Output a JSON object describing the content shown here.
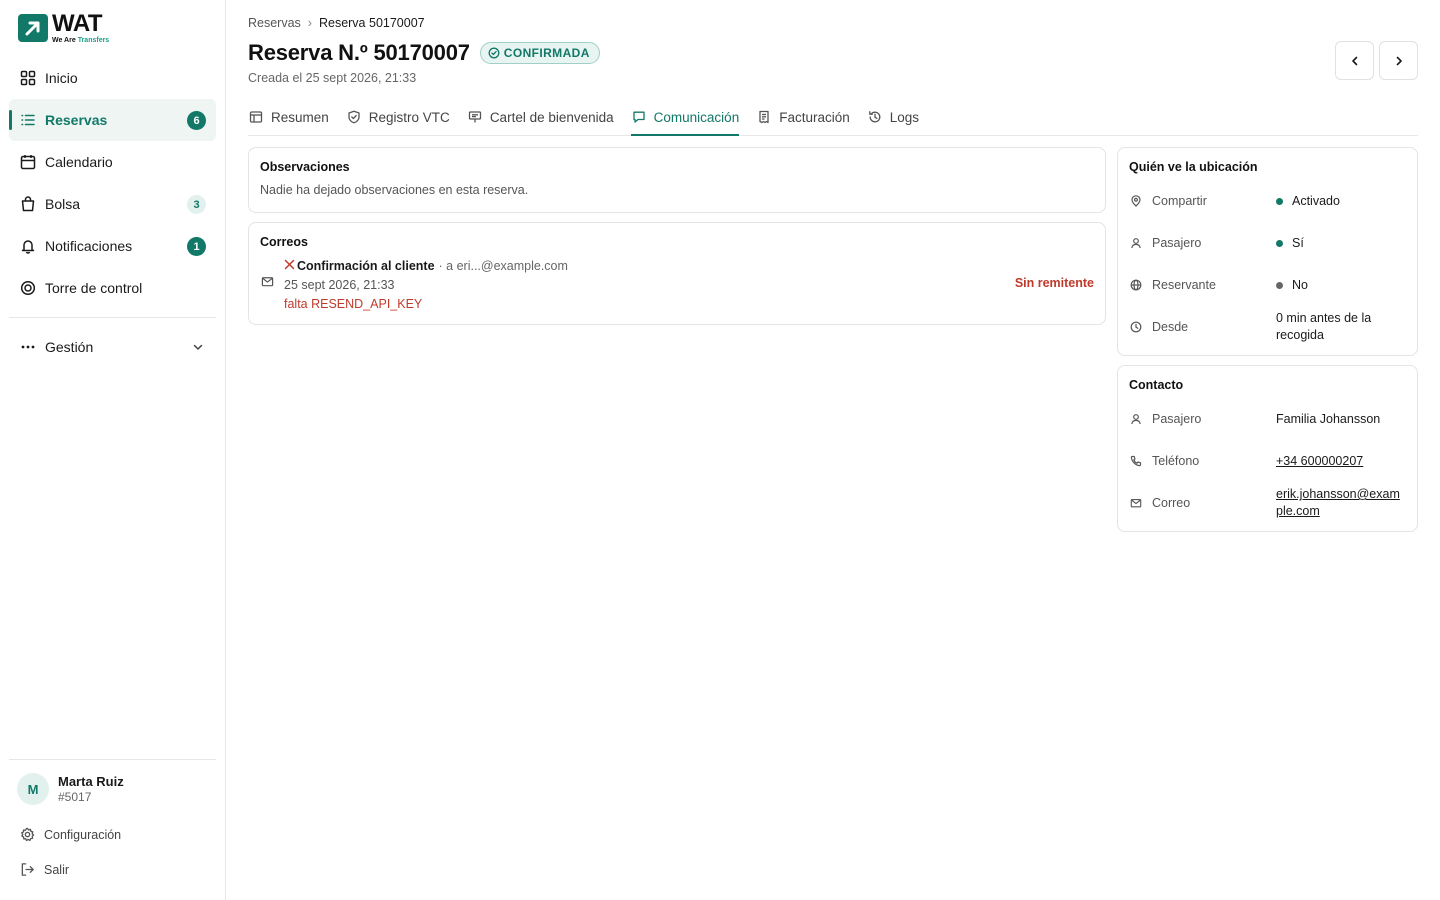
{
  "brand": {
    "name": "WAT",
    "tagline_a": "We Are ",
    "tagline_b": "Transfers",
    "color": "#127868"
  },
  "sidebar": {
    "items": [
      {
        "label": "Inicio",
        "icon": "grid-icon"
      },
      {
        "label": "Reservas",
        "icon": "list-icon",
        "badge": "6",
        "active": true
      },
      {
        "label": "Calendario",
        "icon": "calendar-icon"
      },
      {
        "label": "Bolsa",
        "icon": "bag-icon",
        "badge": "3"
      },
      {
        "label": "Notificaciones",
        "icon": "bell-icon",
        "badge": "1"
      },
      {
        "label": "Torre de control",
        "icon": "target-icon"
      }
    ],
    "management": {
      "label": "Gestión",
      "icon": "dots-icon"
    },
    "user": {
      "initial": "M",
      "name": "Marta Ruiz",
      "id": "#5017"
    },
    "footer": [
      {
        "label": "Configuración",
        "icon": "gear-icon"
      },
      {
        "label": "Salir",
        "icon": "logout-icon"
      }
    ]
  },
  "header": {
    "breadcrumb": [
      "Reservas",
      "Reserva 50170007"
    ],
    "title": "Reserva N.º 50170007",
    "status": "CONFIRMADA",
    "created": "Creada el 25 sept 2026, 21:33"
  },
  "tabs": [
    {
      "label": "Resumen",
      "icon": "summary-icon"
    },
    {
      "label": "Registro VTC",
      "icon": "shield-icon"
    },
    {
      "label": "Cartel de bienvenida",
      "icon": "sign-icon"
    },
    {
      "label": "Comunicación",
      "icon": "chat-icon",
      "active": true
    },
    {
      "label": "Facturación",
      "icon": "receipt-icon"
    },
    {
      "label": "Logs",
      "icon": "history-icon"
    }
  ],
  "observations": {
    "title": "Observaciones",
    "text": "Nadie ha dejado observaciones en esta reserva."
  },
  "emails": {
    "title": "Correos",
    "items": [
      {
        "subject": "Confirmación al cliente",
        "to": "· a eri...@example.com",
        "date": "25 sept 2026, 21:33",
        "error": "falta RESEND_API_KEY",
        "status": "Sin remitente"
      }
    ]
  },
  "location": {
    "title": "Quién ve la ubicación",
    "rows": [
      {
        "key": "Compartir",
        "icon": "pin-icon",
        "value": "Activado",
        "dot": "#127868"
      },
      {
        "key": "Pasajero",
        "icon": "user-icon",
        "value": "Sí",
        "dot": "#127868"
      },
      {
        "key": "Reservante",
        "icon": "globe-icon",
        "value": "No",
        "dot": "#666666"
      },
      {
        "key": "Desde",
        "icon": "clock-icon",
        "value": "0 min antes de la recogida"
      }
    ]
  },
  "contact": {
    "title": "Contacto",
    "rows": [
      {
        "key": "Pasajero",
        "icon": "user-icon",
        "value": "Familia Johansson"
      },
      {
        "key": "Teléfono",
        "icon": "phone-icon",
        "value": "+34 600000207",
        "link": true
      },
      {
        "key": "Correo",
        "icon": "mail-icon",
        "value": "erik.johansson@example.com",
        "link": true
      }
    ]
  }
}
